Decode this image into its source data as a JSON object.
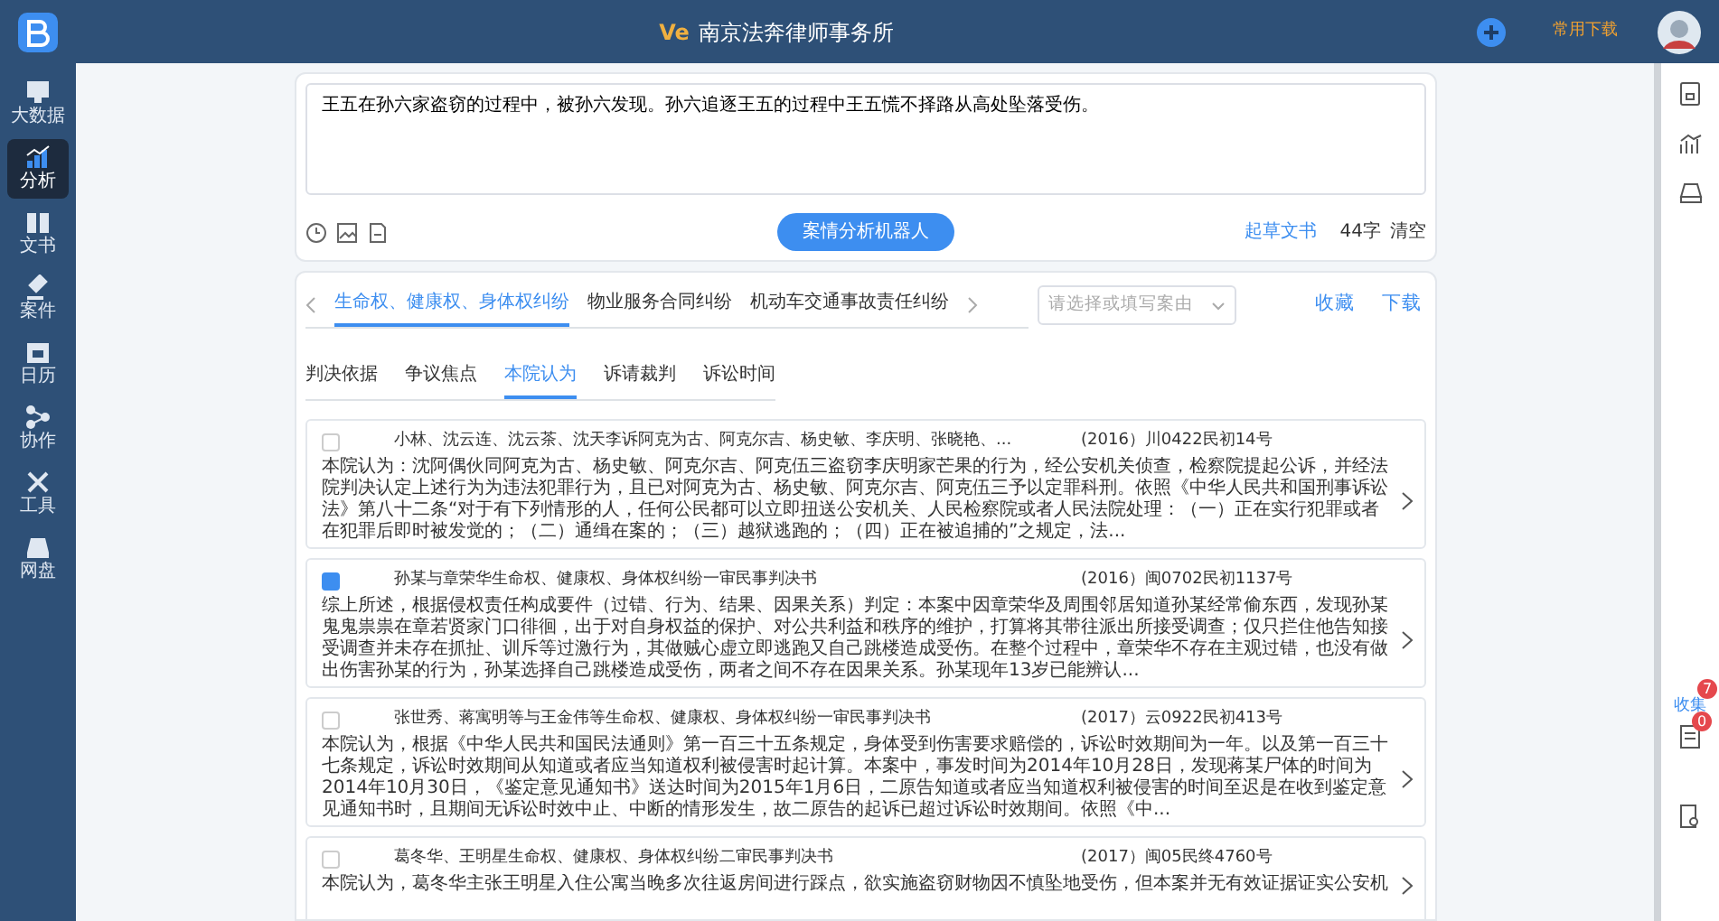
{
  "header": {
    "brand_mark": "Ve",
    "title": "南京法奔律师事务所",
    "downloads_link": "常用下载"
  },
  "sidebar": {
    "items": [
      {
        "label": "大数据",
        "selected": false
      },
      {
        "label": "分析",
        "selected": true
      },
      {
        "label": "文书",
        "selected": false
      },
      {
        "label": "案件",
        "selected": false
      },
      {
        "label": "日历",
        "selected": false
      },
      {
        "label": "协作",
        "selected": false
      },
      {
        "label": "工具",
        "selected": false
      },
      {
        "label": "网盘",
        "selected": false
      }
    ]
  },
  "query": {
    "text": "王五在孙六家盗窃的过程中，被孙六发现。孙六追逐王五的过程中王五慌不择路从高处坠落受伤。",
    "robot_button": "案情分析机器人",
    "draft_link": "起草文书",
    "char_count": "44字",
    "clear_link": "清空"
  },
  "cause_tabs": [
    {
      "label": "生命权、健康权、身体权纠纷",
      "selected": true
    },
    {
      "label": "物业服务合同纠纷",
      "selected": false
    },
    {
      "label": "机动车交通事故责任纠纷",
      "selected": false
    }
  ],
  "cause_select": {
    "placeholder": "请选择或填写案由"
  },
  "actions": [
    "收藏",
    "下载"
  ],
  "section_tabs": [
    {
      "label": "判决依据",
      "selected": false
    },
    {
      "label": "争议焦点",
      "selected": false
    },
    {
      "label": "本院认为",
      "selected": true
    },
    {
      "label": "诉请裁判",
      "selected": false
    },
    {
      "label": "诉讼时间",
      "selected": false
    }
  ],
  "cases": [
    {
      "checked": false,
      "title": "小林、沈云连、沈云茶、沈天李诉阿克为古、阿克尔吉、杨史敏、李庆明、张晓艳、...",
      "case_number": "(2016）川0422民初14号",
      "summary": "本院认为：沈阿偶伙同阿克为古、杨史敏、阿克尔吉、阿克伍三盗窃李庆明家芒果的行为，经公安机关侦查，检察院提起公诉，并经法院判决认定上述行为为违法犯罪行为，且已对阿克为古、杨史敏、阿克尔吉、阿克伍三予以定罪科刑。依照《中华人民共和国刑事诉讼法》第八十二条“对于有下列情形的人，任何公民都可以立即扭送公安机关、人民检察院或者人民法院处理：（一）正在实行犯罪或者在犯罪后即时被发觉的；（二）通缉在案的；（三）越狱逃跑的；（四）正在被追捕的”之规定，法..."
    },
    {
      "checked": true,
      "title": "孙某与章荣华生命权、健康权、身体权纠纷一审民事判决书",
      "case_number": "(2016）闽0702民初1137号",
      "summary": "综上所述，根据侵权责任构成要件（过错、行为、结果、因果关系）判定：本案中因章荣华及周围邻居知道孙某经常偷东西，发现孙某鬼鬼祟祟在章若贤家门口徘徊，出于对自身权益的保护、对公共利益和秩序的维护，打算将其带往派出所接受调查；仅只拦住他告知接受调查并未存在抓扯、训斥等过激行为，其做贼心虚立即逃跑又自己跳楼造成受伤。在整个过程中，章荣华不存在主观过错，也没有做出伤害孙某的行为，孙某选择自己跳楼造成受伤，两者之间不存在因果关系。孙某现年13岁已能辨认..."
    },
    {
      "checked": false,
      "title": "张世秀、蒋寓明等与王金伟等生命权、健康权、身体权纠纷一审民事判决书",
      "case_number": "(2017）云0922民初413号",
      "summary": "本院认为，根据《中华人民共和国民法通则》第一百三十五条规定，身体受到伤害要求赔偿的，诉讼时效期间为一年。以及第一百三十七条规定，诉讼时效期间从知道或者应当知道权利被侵害时起计算。本案中，事发时间为2014年10月28日，发现蒋某尸体的时间为2014年10月30日，《鉴定意见通知书》送达时间为2015年1月6日，二原告知道或者应当知道权利被侵害的时间至迟是在收到鉴定意见通知书时，且期间无诉讼时效中止、中断的情形发生，故二原告的起诉已超过诉讼时效期间。依照《中..."
    },
    {
      "checked": false,
      "title": "葛冬华、王明星生命权、健康权、身体权纠纷二审民事判决书",
      "case_number": "(2017）闽05民终4760号",
      "summary": "本院认为，葛冬华主张王明星入住公寓当晚多次往返房间进行踩点，欲实施盗窃财物因不慎坠地受伤，但本案并无有效证据证实公安机"
    }
  ],
  "right_rail": {
    "collect_label": "收集",
    "collect_badge": "7",
    "list_badge": "0"
  }
}
